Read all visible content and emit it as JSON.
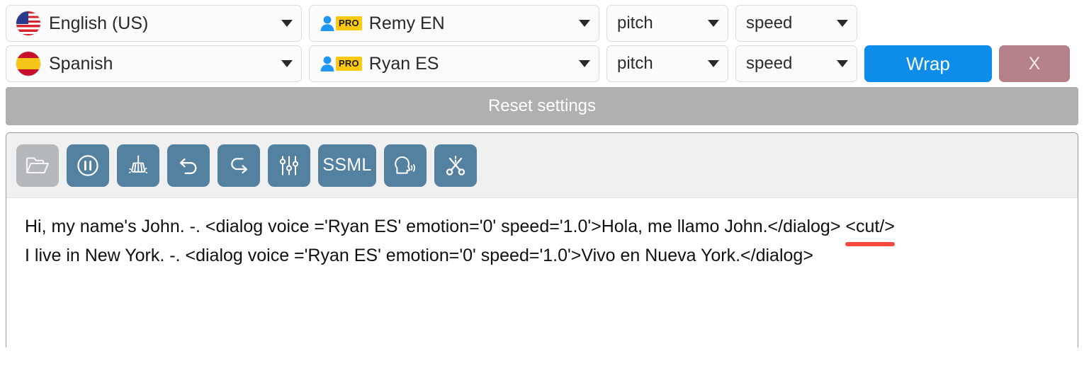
{
  "settings": {
    "rows": [
      {
        "language": {
          "label": "English (US)",
          "flag": "flag-us-icon"
        },
        "voice": {
          "label": "Remy EN",
          "badge": "PRO",
          "icon": "person-icon"
        },
        "pitch": {
          "label": "pitch"
        },
        "speed": {
          "label": "speed"
        }
      },
      {
        "language": {
          "label": "Spanish",
          "flag": "flag-es-icon"
        },
        "voice": {
          "label": "Ryan ES",
          "badge": "PRO",
          "icon": "person-icon"
        },
        "pitch": {
          "label": "pitch"
        },
        "speed": {
          "label": "speed"
        }
      }
    ],
    "wrap_button": "Wrap",
    "close_button": "X",
    "reset_button": "Reset settings"
  },
  "toolbar": {
    "buttons": [
      {
        "name": "open-folder-button",
        "icon": "folder-open-icon",
        "disabled": true
      },
      {
        "name": "pause-button",
        "icon": "pause-circle-icon",
        "disabled": false
      },
      {
        "name": "clean-button",
        "icon": "broom-icon",
        "disabled": false
      },
      {
        "name": "undo-button",
        "icon": "undo-arrow-icon",
        "disabled": false
      },
      {
        "name": "redo-button",
        "icon": "redo-arrow-icon",
        "disabled": false
      },
      {
        "name": "settings-sliders-button",
        "icon": "sliders-icon",
        "disabled": false
      },
      {
        "name": "ssml-button",
        "icon": "ssml-text",
        "label": "SSML",
        "disabled": false
      },
      {
        "name": "voice-preview-button",
        "icon": "head-speaking-icon",
        "disabled": false
      },
      {
        "name": "cut-button",
        "icon": "scissors-icon",
        "disabled": false
      }
    ]
  },
  "editor": {
    "lines": [
      {
        "text": "Hi, my name's John.  -. <dialog voice ='Ryan ES' emotion='0' speed='1.0'>Hola, me llamo John.</dialog> ",
        "marked": "<cut/>"
      },
      {
        "text": "I live in New York. -. <dialog voice ='Ryan ES' emotion='0' speed='1.0'>Vivo en Nueva York.</dialog>",
        "marked": ""
      }
    ]
  },
  "colors": {
    "wrap_blue": "#0d8ce8",
    "close_rose": "#b4808a",
    "toolbar_blue": "#54819f",
    "reset_gray": "#b0b0b0",
    "pro_yellow": "#fdc90f",
    "spell_underline": "#f9483f"
  }
}
